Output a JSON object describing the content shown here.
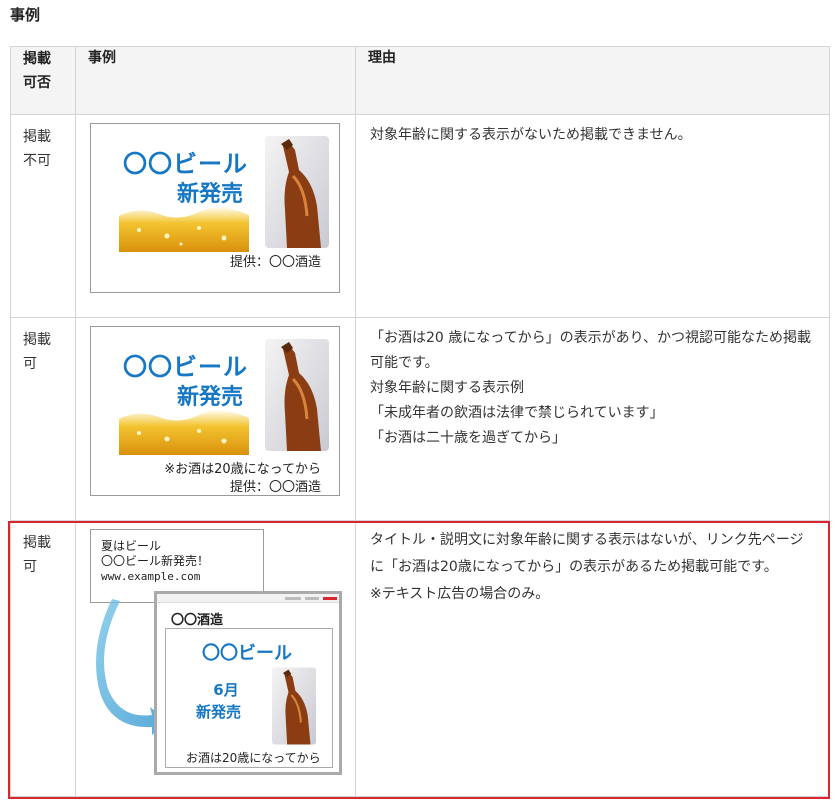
{
  "page": {
    "section_title": "事例"
  },
  "table": {
    "headers": {
      "status": "掲載\n可否",
      "example": "事例",
      "reason": "理由"
    },
    "rows": [
      {
        "status": "掲載\n不可",
        "ad": {
          "brand": "〇〇ビール",
          "launch": "新発売",
          "note": "提供：〇〇酒造"
        },
        "reason": [
          "対象年齢に関する表示がないため掲載できません。"
        ]
      },
      {
        "status": "掲載\n可",
        "ad": {
          "brand": "〇〇ビール",
          "launch": "新発売",
          "note_line1": "※お酒は20歳になってから",
          "note_line2": "提供：〇〇酒造"
        },
        "reason": [
          "「お酒は20 歳になってから」の表示があり、かつ視認可能なため掲載可能です。",
          "対象年齢に関する表示例",
          "「未成年者の飲酒は法律で禁じられています」",
          "「お酒は二十歳を過ぎてから」"
        ]
      },
      {
        "status": "掲載\n可",
        "text_ad": {
          "title": "夏はビール",
          "description": "〇〇ビール新発売！",
          "url": "www.example.com"
        },
        "landing": {
          "site": "〇〇酒造",
          "brand": "〇〇ビール",
          "month": "6月",
          "launch": "新発売",
          "note": "お酒は20歳になってから"
        },
        "reason": [
          "タイトル・説明文に対象年齢に関する表示はないが、リンク先ページに「お酒は20歳になってから」の表示があるため掲載可能です。",
          "※テキスト広告の場合のみ。"
        ]
      }
    ]
  },
  "colors": {
    "highlight": "#d9262e",
    "brand_blue": "#1677c4",
    "header_bg": "#f4f4f4"
  }
}
